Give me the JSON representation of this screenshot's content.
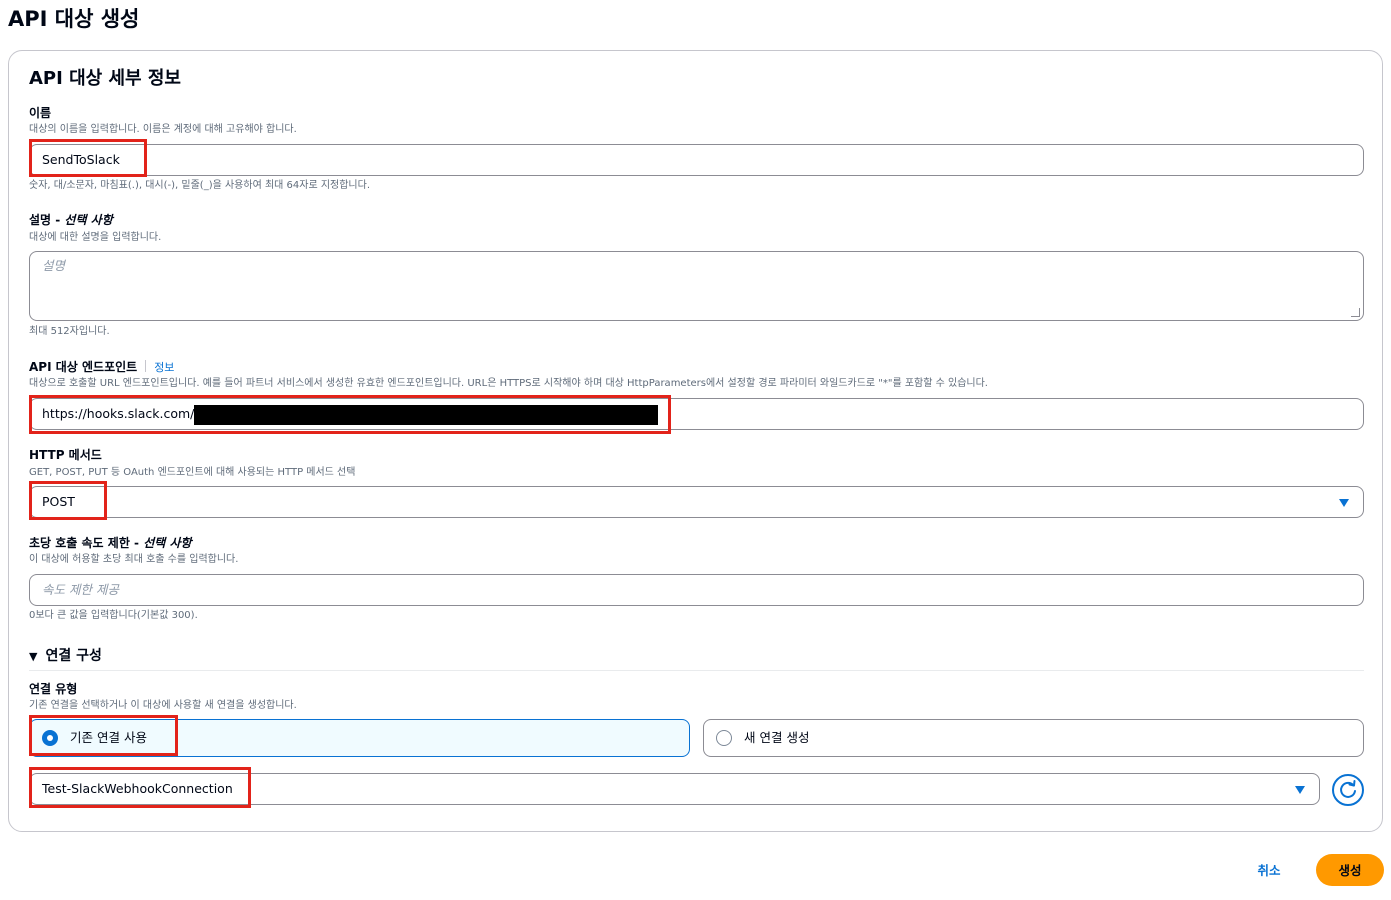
{
  "page": {
    "title": "API 대상 생성"
  },
  "section": {
    "title": "API 대상 세부 정보"
  },
  "name_field": {
    "label": "이름",
    "description": "대상의 이름을 입력합니다. 이름은 계정에 대해 고유해야 합니다.",
    "value": "SendToSlack",
    "constraint": "숫자, 대/소문자, 마침표(.), 대시(-), 밑줄(_)을 사용하여 최대 64자로 지정합니다."
  },
  "description_field": {
    "label": "설명 - ",
    "label_optional": "선택 사항",
    "description": "대상에 대한 설명을 입력합니다.",
    "placeholder": "설명",
    "constraint": "최대 512자입니다."
  },
  "endpoint_field": {
    "label": "API 대상 엔드포인트",
    "info_link": "정보",
    "description": "대상으로 호출할 URL 엔드포인트입니다. 예를 들어 파트너 서비스에서 생성한 유효한 엔드포인트입니다. URL은 HTTPS로 시작해야 하며 대상 HttpParameters에서 설정할 경로 파라미터 와일드카드로 \"*\"를 포함할 수 있습니다.",
    "value": "https://hooks.slack.com/"
  },
  "http_method_field": {
    "label": "HTTP 메서드",
    "description": "GET, POST, PUT 등 OAuth 엔드포인트에 대해 사용되는 HTTP 메서드 선택",
    "value": "POST"
  },
  "rate_limit_field": {
    "label": "초당 호출 속도 제한 - ",
    "label_optional": "선택 사항",
    "description": "이 대상에 허용할 초당 최대 호출 수를 입력합니다.",
    "placeholder": "속도 제한 제공",
    "constraint": "0보다 큰 값을 입력합니다(기본값 300)."
  },
  "connection_config": {
    "title": "연결 구성",
    "type_label": "연결 유형",
    "type_description": "기존 연결을 선택하거나 이 대상에 사용할 새 연결을 생성합니다.",
    "option_existing": "기존 연결 사용",
    "option_new": "새 연결 생성",
    "selected_connection": "Test-SlackWebhookConnection"
  },
  "footer": {
    "cancel_label": "취소",
    "create_label": "생성"
  },
  "colors": {
    "accent": "#0972d3",
    "primary_button": "#ff9900",
    "highlight_box": "#e2231a"
  }
}
